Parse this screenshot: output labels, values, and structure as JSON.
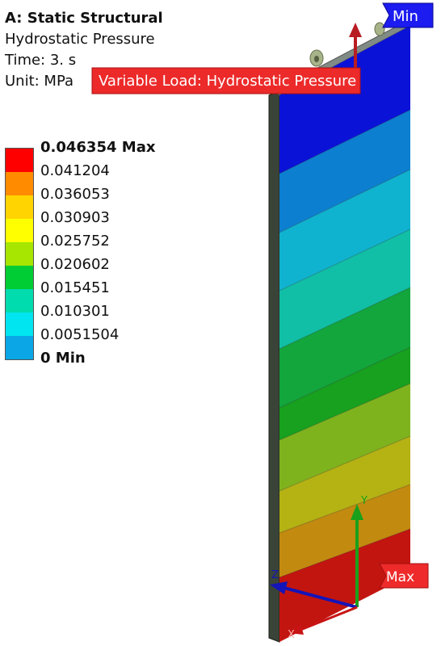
{
  "header": {
    "title": "A: Static Structural",
    "result": "Hydrostatic Pressure",
    "time": "Time: 3. s",
    "unit": "Unit: MPa"
  },
  "legend": {
    "labels": [
      "0.046354 Max",
      "0.041204",
      "0.036053",
      "0.030903",
      "0.025752",
      "0.020602",
      "0.015451",
      "0.010301",
      "0.0051504",
      "0 Min"
    ],
    "colors": [
      "#ff0000",
      "#ff8c00",
      "#ffd400",
      "#ffff00",
      "#a6e600",
      "#00cc33",
      "#00dcae",
      "#00e5f0",
      "#0aa6e6",
      "#0000ff"
    ]
  },
  "callouts": {
    "load_label": "Variable Load: Hydrostatic Pressure",
    "min_label": "Min",
    "max_label": "Max"
  },
  "axes": {
    "x": "X",
    "y": "Y",
    "z": "Z"
  },
  "model": {
    "band_colors": [
      "#0b12d8",
      "#0c7fd0",
      "#10b3cf",
      "#11bfa6",
      "#12a63d",
      "#18a01f",
      "#7fb31e",
      "#b5b214",
      "#c38a10",
      "#c31510"
    ],
    "edge_color": "#3a4338"
  }
}
